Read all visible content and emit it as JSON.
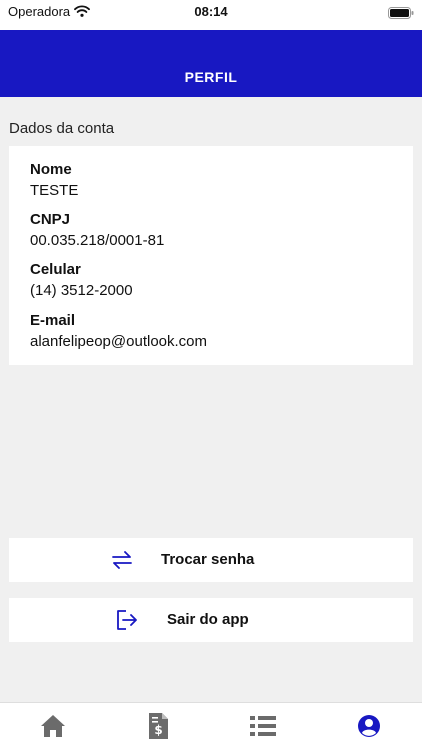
{
  "status_bar": {
    "carrier": "Operadora",
    "time": "08:14"
  },
  "header": {
    "title": "PERFIL"
  },
  "account": {
    "section_title": "Dados da conta",
    "fields": [
      {
        "label": "Nome",
        "value": "TESTE"
      },
      {
        "label": "CNPJ",
        "value": "00.035.218/0001-81"
      },
      {
        "label": "Celular",
        "value": "(14) 3512-2000"
      },
      {
        "label": "E-mail",
        "value": "alanfelipeop@outlook.com"
      }
    ]
  },
  "actions": {
    "change_password": {
      "label": "Trocar senha",
      "icon": "swap-arrows-icon"
    },
    "logout": {
      "label": "Sair do app",
      "icon": "logout-icon"
    }
  },
  "tab_bar": {
    "items": [
      {
        "icon": "home-icon",
        "active": false
      },
      {
        "icon": "invoice-dollar-icon",
        "active": false
      },
      {
        "icon": "list-icon",
        "active": false
      },
      {
        "icon": "user-circle-icon",
        "active": true
      }
    ]
  },
  "colors": {
    "brand": "#1818c2",
    "background": "#f0f0f0",
    "tab_inactive": "#6b6b6b"
  }
}
